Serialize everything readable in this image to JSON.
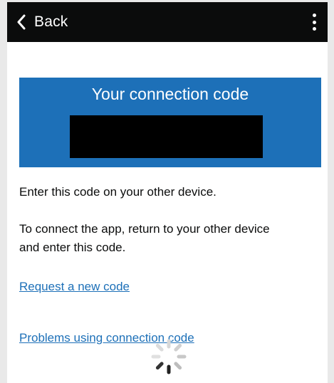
{
  "topbar": {
    "back_label": "Back",
    "back_icon": "chevron-left-icon",
    "menu_icon": "more-vertical-icon"
  },
  "code_panel": {
    "title": "Your connection code",
    "code_redacted": true
  },
  "instructions": {
    "line1": "Enter this code on your other device.",
    "para2_line1": "To connect the app, return to your other device",
    "para2_line2": "and enter this code."
  },
  "links": {
    "request_new_code": "Request a new code",
    "problems": "Problems using connection code"
  },
  "loading": {
    "icon": "spinner-icon"
  },
  "colors": {
    "topbar_bg": "#0b0c0c",
    "panel_bg": "#1d70b8",
    "link": "#1d70b8",
    "text": "#0b0c0c"
  }
}
